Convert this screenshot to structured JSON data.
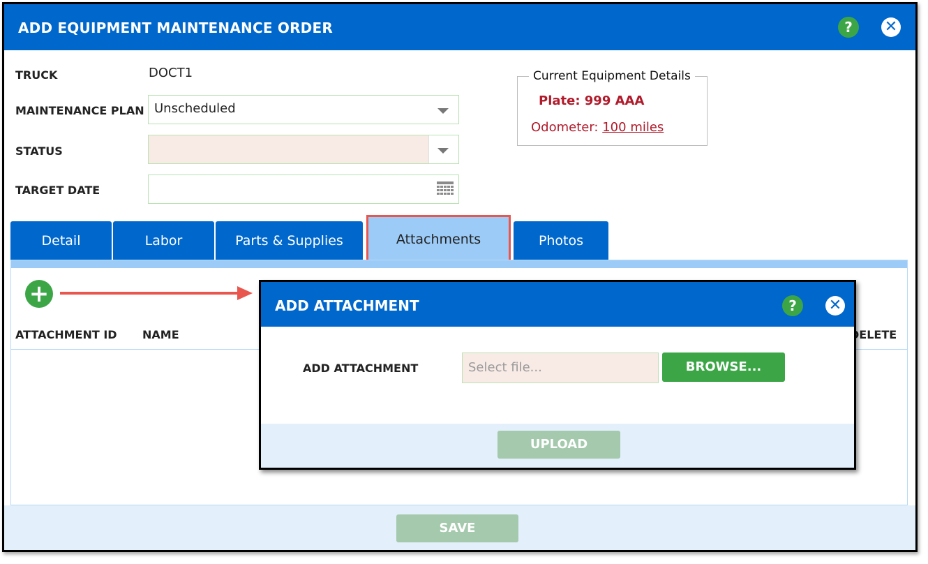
{
  "window": {
    "title": "ADD EQUIPMENT MAINTENANCE ORDER",
    "help_glyph": "?",
    "close_glyph": "✕"
  },
  "form": {
    "truck_label": "TRUCK",
    "truck_value": "DOCT1",
    "plan_label": "MAINTENANCE PLAN",
    "plan_value": "Unscheduled",
    "status_label": "STATUS",
    "status_value": "",
    "target_date_label": "TARGET DATE",
    "target_date_value": ""
  },
  "equipment": {
    "legend": "Current Equipment Details",
    "plate_text": "Plate: 999 AAA",
    "odometer_label": "Odometer:",
    "odometer_value": "100 miles"
  },
  "tabs": [
    {
      "label": "Detail"
    },
    {
      "label": "Labor"
    },
    {
      "label": "Parts & Supplies"
    },
    {
      "label": "Attachments"
    },
    {
      "label": "Photos"
    }
  ],
  "active_tab": "Attachments",
  "attachments_table": {
    "add_glyph": "+",
    "columns": [
      "ATTACHMENT ID",
      "NAME",
      "DELETE"
    ],
    "rows": []
  },
  "footer": {
    "save_label": "SAVE"
  },
  "modal": {
    "title": "ADD ATTACHMENT",
    "help_glyph": "?",
    "close_glyph": "✕",
    "field_label": "ADD ATTACHMENT",
    "file_placeholder": "Select file...",
    "browse_label": "BROWSE...",
    "upload_label": "UPLOAD"
  },
  "colors": {
    "primary": "#0067cc",
    "tab_active": "#9ccbf7",
    "success": "#3ca646",
    "disabled_button": "#a4c9ac",
    "alert_text": "#b01a2a",
    "highlight": "#e8564e"
  },
  "icons": {
    "help": "help-icon",
    "close": "close-icon",
    "dropdown": "chevron-down-icon",
    "calendar": "calendar-icon",
    "add": "plus-circle-icon",
    "annotation_arrow": "arrow-right-icon"
  }
}
